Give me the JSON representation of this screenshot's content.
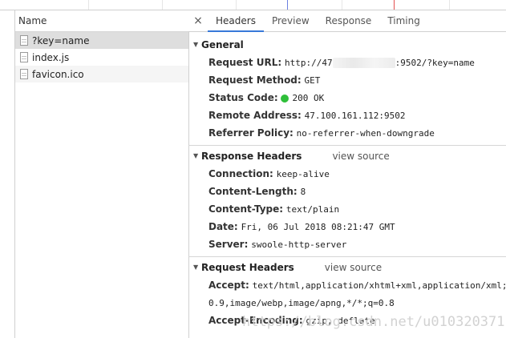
{
  "network_list": {
    "header": "Name",
    "items": [
      {
        "name": "?key=name"
      },
      {
        "name": "index.js"
      },
      {
        "name": "favicon.ico"
      }
    ]
  },
  "tabs": {
    "close": "×",
    "items": [
      "Headers",
      "Preview",
      "Response",
      "Timing"
    ],
    "active": "Headers"
  },
  "general": {
    "title": "General",
    "request_url_label": "Request URL:",
    "request_url_prefix": "http://47",
    "request_url_suffix": ":9502/?key=name",
    "request_method_label": "Request Method:",
    "request_method": "GET",
    "status_code_label": "Status Code:",
    "status_code": "200 OK",
    "status_color": "#2fbf3a",
    "remote_address_label": "Remote Address:",
    "remote_address": "47.100.161.112:9502",
    "referrer_policy_label": "Referrer Policy:",
    "referrer_policy": "no-referrer-when-downgrade"
  },
  "response_headers": {
    "title": "Response Headers",
    "view_source": "view source",
    "connection_label": "Connection:",
    "connection": "keep-alive",
    "content_length_label": "Content-Length:",
    "content_length": "8",
    "content_type_label": "Content-Type:",
    "content_type": "text/plain",
    "date_label": "Date:",
    "date": "Fri, 06 Jul 2018 08:21:47 GMT",
    "server_label": "Server:",
    "server": "swoole-http-server"
  },
  "request_headers": {
    "title": "Request Headers",
    "view_source": "view source",
    "accept_label": "Accept:",
    "accept": "text/html,application/xhtml+xml,application/xml;q",
    "accept_cont": "0.9,image/webp,image/apng,*/*;q=0.8",
    "accept_encoding_label": "Accept-Encoding:",
    "accept_encoding": "gzip, deflate"
  },
  "watermark": "https://blog.csdn.net/u010320371"
}
